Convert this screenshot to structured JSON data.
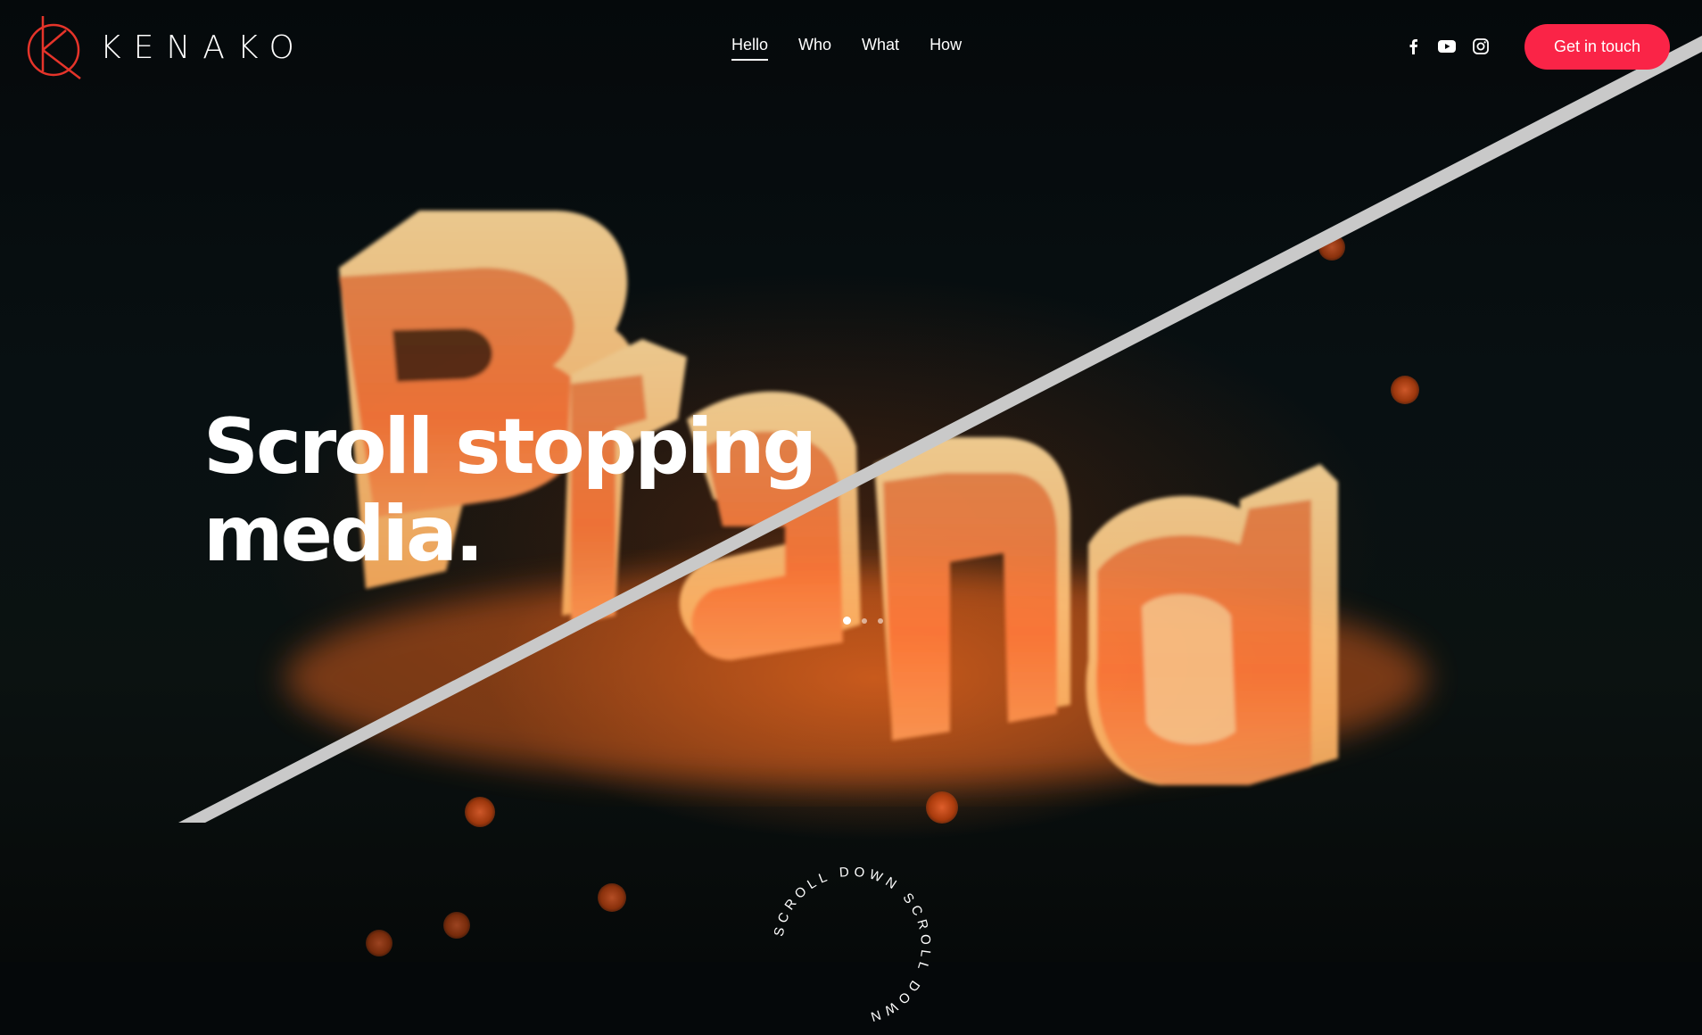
{
  "brand": {
    "name": "KENAKO",
    "accent": "#fa2447",
    "logo_color": "#e5342a"
  },
  "nav": {
    "items": [
      {
        "label": "Hello",
        "active": true
      },
      {
        "label": "Who",
        "active": false
      },
      {
        "label": "What",
        "active": false
      },
      {
        "label": "How",
        "active": false
      }
    ]
  },
  "social": {
    "icons": [
      "facebook-icon",
      "youtube-icon",
      "instagram-icon"
    ]
  },
  "cta": {
    "label": "Get in touch"
  },
  "hero": {
    "headline_line1": "Scroll stopping",
    "headline_line2": "media.",
    "background_word": "Brand",
    "slides": {
      "count": 3,
      "active": 1
    }
  },
  "scroll_badge": {
    "text": "SCROLL DOWN SCROLL DOWN "
  }
}
